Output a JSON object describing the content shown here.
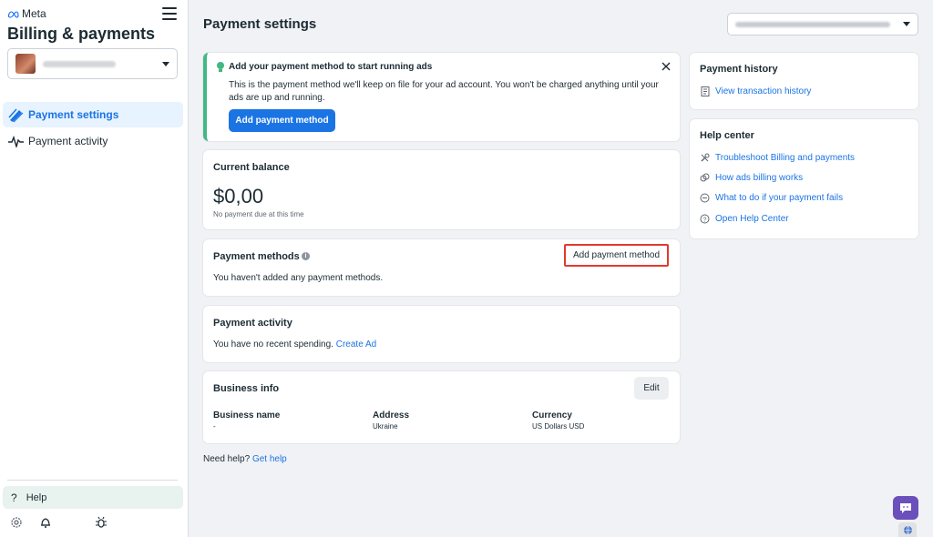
{
  "sidebar": {
    "brand": "Meta",
    "title": "Billing & payments",
    "nav": [
      {
        "label": "Payment settings",
        "active": true,
        "icon": "pencil-card-icon"
      },
      {
        "label": "Payment activity",
        "active": false,
        "icon": "pulse-icon"
      }
    ],
    "help_label": "Help",
    "bottom_icons": [
      "gear-icon",
      "bell-icon",
      "bug-icon"
    ]
  },
  "header": {
    "title": "Payment settings"
  },
  "banner": {
    "title": "Add your payment method to start running ads",
    "text": "This is the payment method we'll keep on file for your ad account. You won't be charged anything until your ads are up and running.",
    "button": "Add payment method",
    "accent": "#42b883"
  },
  "balance": {
    "title": "Current balance",
    "amount": "$0,00",
    "note": "No payment due at this time"
  },
  "payment_methods": {
    "title": "Payment methods",
    "empty_text": "You haven't added any payment methods.",
    "button": "Add payment method"
  },
  "payment_activity": {
    "title": "Payment activity",
    "text": "You have no recent spending.",
    "link": "Create Ad"
  },
  "business_info": {
    "title": "Business info",
    "edit": "Edit",
    "fields": [
      {
        "label": "Business name",
        "value": "-"
      },
      {
        "label": "Address",
        "value": "Ukraine"
      },
      {
        "label": "Currency",
        "value": "US Dollars USD"
      }
    ]
  },
  "need_help": {
    "text": "Need help?",
    "link": "Get help"
  },
  "payment_history": {
    "title": "Payment history",
    "link": "View transaction history"
  },
  "help_center": {
    "title": "Help center",
    "links": [
      {
        "label": "Troubleshoot Billing and payments",
        "icon": "wrench-icon"
      },
      {
        "label": "How ads billing works",
        "icon": "coins-icon"
      },
      {
        "label": "What to do if your payment fails",
        "icon": "minus-circle-icon"
      },
      {
        "label": "Open Help Center",
        "icon": "question-circle-icon"
      }
    ]
  },
  "colors": {
    "primary": "#1b74e4",
    "highlight_border": "#e23a2e",
    "chat": "#6b4fbb"
  }
}
